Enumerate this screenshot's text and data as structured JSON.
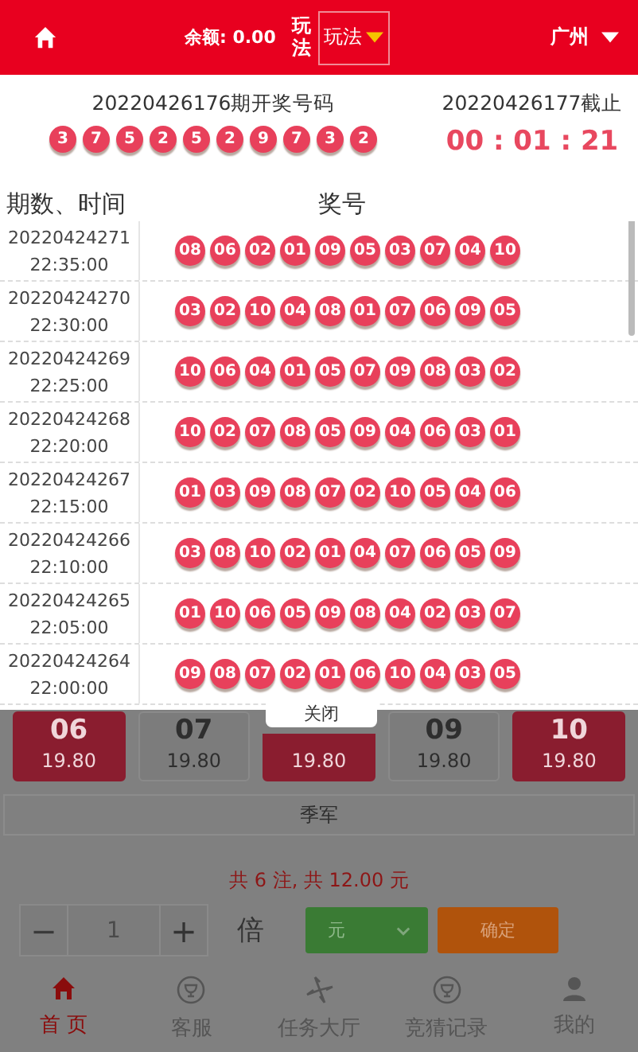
{
  "header": {
    "balance": "余额: 0.00",
    "play_label": "玩法",
    "play_select": "玩法",
    "city": "广州"
  },
  "popup": {
    "current": {
      "title": "20220426176期开奖号码",
      "balls": [
        "3",
        "7",
        "5",
        "2",
        "5",
        "2",
        "9",
        "7",
        "3",
        "2"
      ]
    },
    "next": {
      "title": "20220426177截止",
      "countdown": "00 : 01 : 21"
    },
    "table": {
      "columns": [
        "期数、时间",
        "奖号"
      ],
      "rows": [
        {
          "issue": "20220424271",
          "time": "22:35:00",
          "balls": [
            "08",
            "06",
            "02",
            "01",
            "09",
            "05",
            "03",
            "07",
            "04",
            "10"
          ]
        },
        {
          "issue": "20220424270",
          "time": "22:30:00",
          "balls": [
            "03",
            "02",
            "10",
            "04",
            "08",
            "01",
            "07",
            "06",
            "09",
            "05"
          ]
        },
        {
          "issue": "20220424269",
          "time": "22:25:00",
          "balls": [
            "10",
            "06",
            "04",
            "01",
            "05",
            "07",
            "09",
            "08",
            "03",
            "02"
          ]
        },
        {
          "issue": "20220424268",
          "time": "22:20:00",
          "balls": [
            "10",
            "02",
            "07",
            "08",
            "05",
            "09",
            "04",
            "06",
            "03",
            "01"
          ]
        },
        {
          "issue": "20220424267",
          "time": "22:15:00",
          "balls": [
            "01",
            "03",
            "09",
            "08",
            "07",
            "02",
            "10",
            "05",
            "04",
            "06"
          ]
        },
        {
          "issue": "20220424266",
          "time": "22:10:00",
          "balls": [
            "03",
            "08",
            "10",
            "02",
            "01",
            "04",
            "07",
            "06",
            "05",
            "09"
          ]
        },
        {
          "issue": "20220424265",
          "time": "22:05:00",
          "balls": [
            "01",
            "10",
            "06",
            "05",
            "09",
            "08",
            "04",
            "02",
            "03",
            "07"
          ]
        },
        {
          "issue": "20220424264",
          "time": "22:00:00",
          "balls": [
            "09",
            "08",
            "07",
            "02",
            "01",
            "06",
            "10",
            "04",
            "03",
            "05"
          ]
        }
      ]
    },
    "close_button": "关闭"
  },
  "cards": [
    {
      "number": "06",
      "price": "19.80",
      "selected": true
    },
    {
      "number": "07",
      "price": "19.80",
      "selected": false
    },
    {
      "price": "19.80",
      "selected": true
    },
    {
      "number": "09",
      "price": "19.80",
      "selected": false
    },
    {
      "number": "10",
      "price": "19.80",
      "selected": true
    }
  ],
  "rank_label": "季军",
  "summary": "共 6 注, 共 12.00 元",
  "stepper": {
    "minus": "−",
    "value": "1",
    "plus": "+"
  },
  "multiplier_label": "倍",
  "unit_select": "元",
  "confirm_button": "确定",
  "nav": [
    {
      "label": "首 页",
      "kind": "home",
      "selected": true
    },
    {
      "label": "客服",
      "kind": "badge",
      "selected": false
    },
    {
      "label": "任务大厅",
      "kind": "pinwheel",
      "selected": false
    },
    {
      "label": "竞猜记录",
      "kind": "badge",
      "selected": false
    },
    {
      "label": "我的",
      "kind": "user",
      "selected": false
    }
  ]
}
